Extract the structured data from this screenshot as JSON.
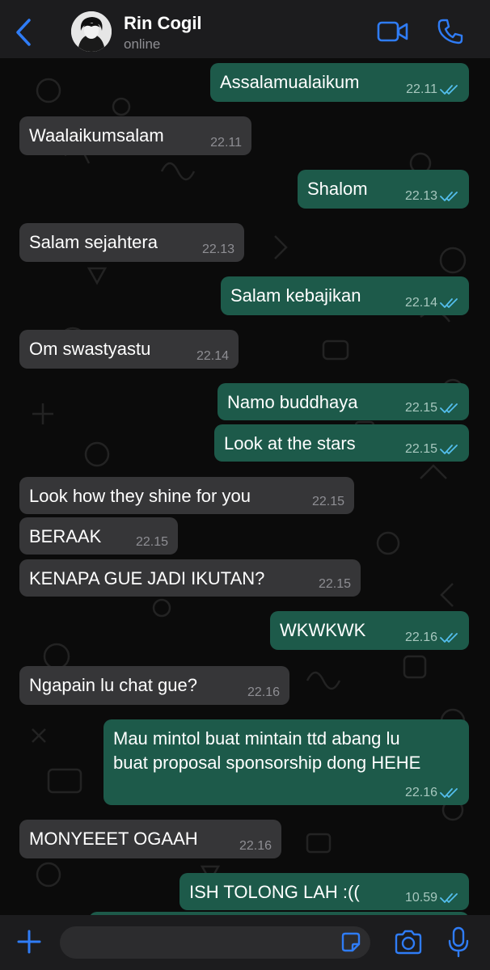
{
  "header": {
    "back_icon": "chevron-left-icon",
    "contact_name": "Rin Cogil",
    "status": "online",
    "video_icon": "video-call-icon",
    "call_icon": "phone-icon"
  },
  "messages": [
    {
      "dir": "out",
      "text": "Assalamualaikum",
      "time": "22.11",
      "read": true
    },
    {
      "dir": "in",
      "text": "Waalaikumsalam",
      "time": "22.11"
    },
    {
      "dir": "out",
      "text": "Shalom",
      "time": "22.13",
      "read": true
    },
    {
      "dir": "in",
      "text": "Salam sejahtera",
      "time": "22.13"
    },
    {
      "dir": "out",
      "text": "Salam kebajikan",
      "time": "22.14",
      "read": true
    },
    {
      "dir": "in",
      "text": "Om swastyastu",
      "time": "22.14"
    },
    {
      "dir": "out",
      "text": "Namo buddhaya",
      "time": "22.15",
      "read": true
    },
    {
      "dir": "out",
      "text": "Look at the stars",
      "time": "22.15",
      "read": true
    },
    {
      "dir": "in",
      "text": "Look how they shine for you",
      "time": "22.15"
    },
    {
      "dir": "in",
      "text": "BERAAK",
      "time": "22.15"
    },
    {
      "dir": "in",
      "text": "KENAPA GUE JADI IKUTAN?",
      "time": "22.15"
    },
    {
      "dir": "out",
      "text": "WKWKWK",
      "time": "22.16",
      "read": true
    },
    {
      "dir": "in",
      "text": "Ngapain lu chat gue?",
      "time": "22.16"
    },
    {
      "dir": "out",
      "text": "Mau mintol buat mintain ttd abang lu buat proposal sponsorship dong HEHE",
      "line1": "Mau mintol buat mintain ttd abang lu",
      "line2": "buat proposal sponsorship dong HEHE",
      "time": "22.16",
      "read": true
    },
    {
      "dir": "in",
      "text": "MONYEEET OGAAH",
      "time": "22.16"
    },
    {
      "dir": "out",
      "text": "ISH TOLONG LAH :((",
      "time": "10.59",
      "read": true
    }
  ],
  "composer": {
    "plus_icon": "plus-icon",
    "input_value": "",
    "sticker_icon": "sticker-icon",
    "camera_icon": "camera-icon",
    "mic_icon": "microphone-icon"
  },
  "colors": {
    "accent": "#2f7cf6",
    "outgoing_bubble": "#1d5a4a",
    "incoming_bubble": "#363638",
    "read_tick": "#53bdeb"
  }
}
